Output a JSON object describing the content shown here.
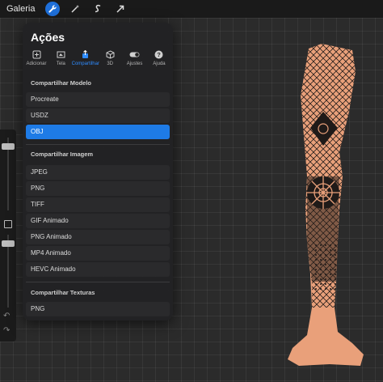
{
  "topbar": {
    "gallery_label": "Galeria",
    "tools": [
      {
        "icon": "wrench-icon",
        "active": true
      },
      {
        "icon": "magic-wand-icon",
        "active": false
      },
      {
        "icon": "selection-s-icon",
        "active": false
      },
      {
        "icon": "transform-arrow-icon",
        "active": false
      }
    ]
  },
  "panel": {
    "title": "Ações",
    "tabs": [
      {
        "label": "Adicionar",
        "icon": "add-icon"
      },
      {
        "label": "Tela",
        "icon": "canvas-icon"
      },
      {
        "label": "Compartilhar",
        "icon": "share-icon",
        "active": true
      },
      {
        "label": "3D",
        "icon": "cube-icon"
      },
      {
        "label": "Ajustes",
        "icon": "toggle-icon"
      },
      {
        "label": "Ajuda",
        "icon": "help-icon"
      }
    ],
    "sections": {
      "model": {
        "label": "Compartilhar Modelo",
        "items": [
          "Procreate",
          "USDZ",
          "OBJ"
        ],
        "selected": "OBJ"
      },
      "image": {
        "label": "Compartilhar Imagem",
        "items": [
          "JPEG",
          "PNG",
          "TIFF",
          "GIF Animado",
          "PNG Animado",
          "MP4 Animado",
          "HEVC Animado"
        ]
      },
      "textures": {
        "label": "Compartilhar Texturas",
        "items": [
          "PNG"
        ]
      }
    }
  },
  "colors": {
    "accent": "#1e7be6",
    "panel_bg": "#222224",
    "skin": "#e9a07a",
    "tattoo": "#1f1a18"
  }
}
